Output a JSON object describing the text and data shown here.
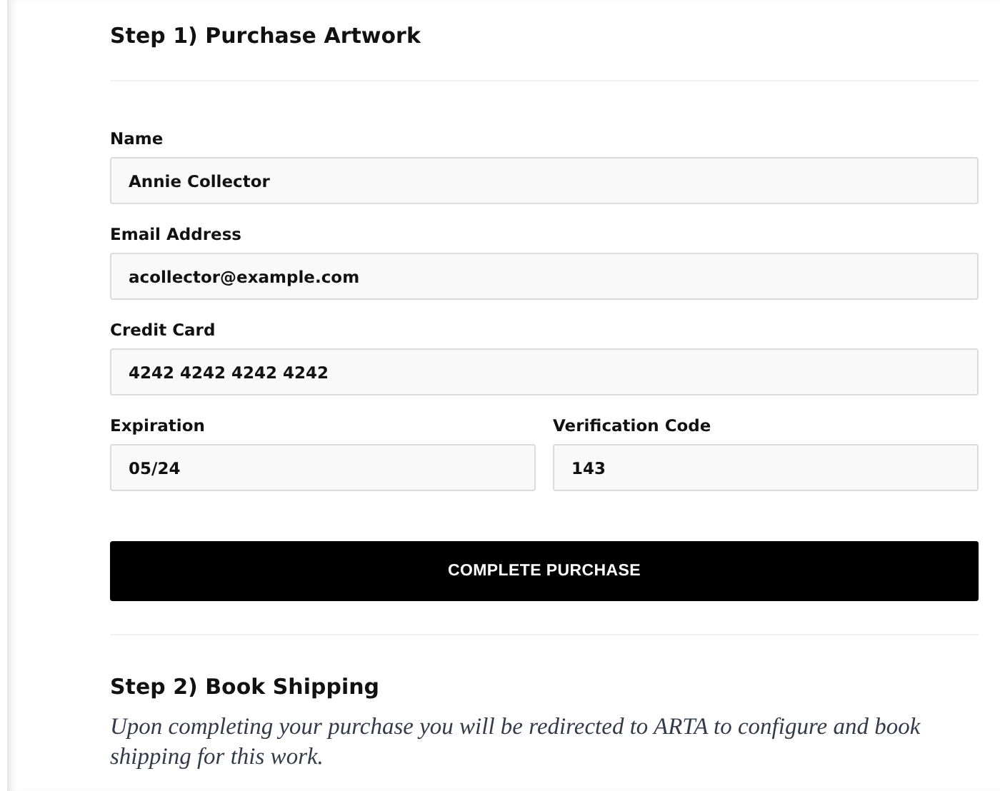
{
  "step1": {
    "title": "Step 1) Purchase Artwork"
  },
  "fields": [
    {
      "label": "Name",
      "value": "Annie Collector",
      "kind": "full"
    },
    {
      "label": "Email Address",
      "value": "acollector@example.com",
      "kind": "full"
    },
    {
      "label": "Credit Card",
      "value": "4242 4242 4242 4242",
      "kind": "full"
    },
    {
      "label": "Expiration",
      "value": "05/24",
      "kind": "half"
    },
    {
      "label": "Verification Code",
      "value": "143",
      "kind": "half"
    }
  ],
  "button": {
    "label": "COMPLETE PURCHASE"
  },
  "step2": {
    "title": "Step 2) Book Shipping",
    "text": "Upon completing your purchase you will be redirected to ARTA to configure and book shipping for this work."
  }
}
